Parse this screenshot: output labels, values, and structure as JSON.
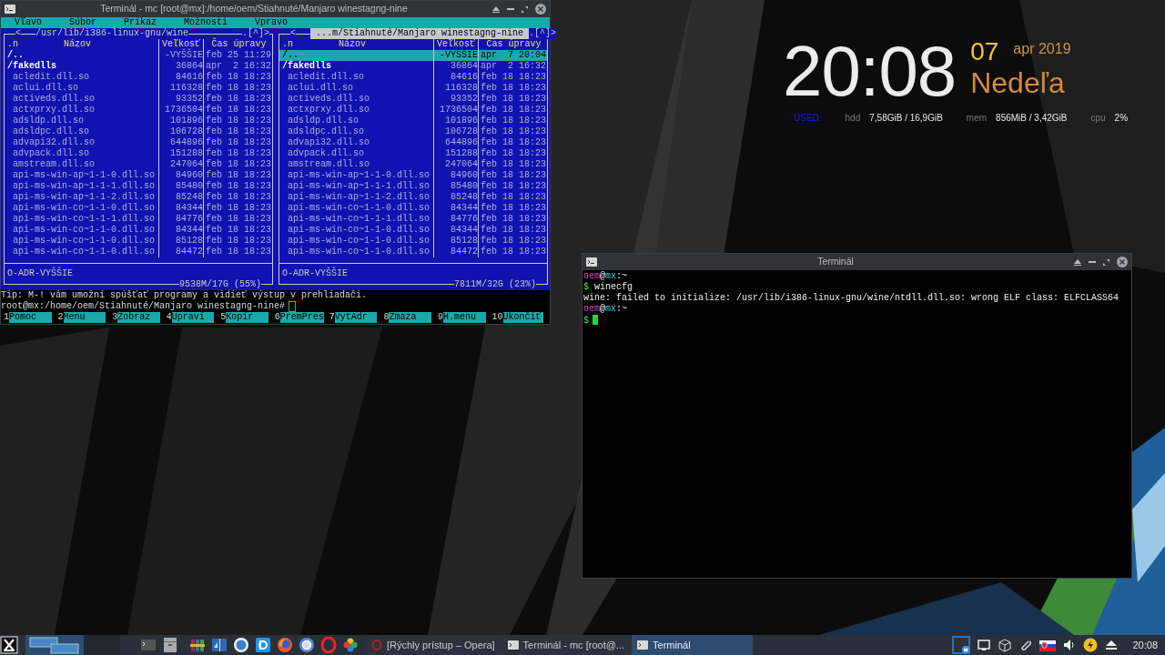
{
  "clock_widget": {
    "time": "20:08",
    "day": "07",
    "month_year": "apr 2019",
    "weekday": "Nedeľa",
    "used_label": "USED:",
    "stats": [
      {
        "label": "hdd",
        "value": "7,58GiB / 16,9GiB"
      },
      {
        "label": "mem",
        "value": "856MiB / 3,42GiB"
      },
      {
        "label": "cpu",
        "value": "2%"
      }
    ]
  },
  "mc_window": {
    "title": "Terminál - mc [root@mx]:/home/oem/Stiahnuté/Manjaro winestagng-nine",
    "menu": [
      "Vľavo",
      "Súbor",
      "Príkaz",
      "Možnosti",
      "Vpravo"
    ],
    "panels": [
      {
        "active": false,
        "marker_left": "<",
        "path": "/usr/lib/i386-linux-gnu/wine",
        "marker_right": ".[^]>",
        "sort": ".n",
        "columns": [
          "Názov",
          "Veľkosť",
          "Čas úpravy"
        ],
        "rows": [
          {
            "name": "/..",
            "size": "-VYŠŠIE",
            "modified": "feb 25 11:29",
            "kind": "dir",
            "selected": false
          },
          {
            "name": "/fakedlls",
            "size": "36864",
            "modified": "apr  2 16:32",
            "kind": "dir",
            "selected": false
          },
          {
            "name": "acledit.dll.so",
            "size": "84616",
            "modified": "feb 18 18:23",
            "kind": "file",
            "selected": false
          },
          {
            "name": "aclui.dll.so",
            "size": "116328",
            "modified": "feb 18 18:23",
            "kind": "file",
            "selected": false
          },
          {
            "name": "activeds.dll.so",
            "size": "93352",
            "modified": "feb 18 18:23",
            "kind": "file",
            "selected": false
          },
          {
            "name": "actxprxy.dll.so",
            "size": "1736504",
            "modified": "feb 18 18:23",
            "kind": "file",
            "selected": false
          },
          {
            "name": "adsldp.dll.so",
            "size": "101896",
            "modified": "feb 18 18:23",
            "kind": "file",
            "selected": false
          },
          {
            "name": "adsldpc.dll.so",
            "size": "106728",
            "modified": "feb 18 18:23",
            "kind": "file",
            "selected": false
          },
          {
            "name": "advapi32.dll.so",
            "size": "644896",
            "modified": "feb 18 18:23",
            "kind": "file",
            "selected": false
          },
          {
            "name": "advpack.dll.so",
            "size": "151288",
            "modified": "feb 18 18:23",
            "kind": "file",
            "selected": false
          },
          {
            "name": "amstream.dll.so",
            "size": "247064",
            "modified": "feb 18 18:23",
            "kind": "file",
            "selected": false
          },
          {
            "name": "api-ms-win-ap~1-1-0.dll.so",
            "size": "84960",
            "modified": "feb 18 18:23",
            "kind": "file",
            "selected": false
          },
          {
            "name": "api-ms-win-ap~1-1-1.dll.so",
            "size": "85480",
            "modified": "feb 18 18:23",
            "kind": "file",
            "selected": false
          },
          {
            "name": "api-ms-win-ap~1-1-2.dll.so",
            "size": "85248",
            "modified": "feb 18 18:23",
            "kind": "file",
            "selected": false
          },
          {
            "name": "api-ms-win-co~1-1-0.dll.so",
            "size": "84344",
            "modified": "feb 18 18:23",
            "kind": "file",
            "selected": false
          },
          {
            "name": "api-ms-win-co~1-1-1.dll.so",
            "size": "84776",
            "modified": "feb 18 18:23",
            "kind": "file",
            "selected": false
          },
          {
            "name": "api-ms-win-co~1-1-0.dll.so",
            "size": "84344",
            "modified": "feb 18 18:23",
            "kind": "file",
            "selected": false
          },
          {
            "name": "api-ms-win-co~1-1-0.dll.so",
            "size": "85128",
            "modified": "feb 18 18:23",
            "kind": "file",
            "selected": false
          },
          {
            "name": "api-ms-win-co~1-1-0.dll.so",
            "size": "84472",
            "modified": "feb 18 18:23",
            "kind": "file",
            "selected": false
          }
        ],
        "mini_status": "O-ADR-VYŠŠIE",
        "disk": "9538M/17G (55%)"
      },
      {
        "active": true,
        "marker_left": "<",
        "path": " ...m/Stiahnuté/Manjaro winestagng-nine ",
        "marker_right": ".[^]>",
        "sort": ".n",
        "columns": [
          "Názov",
          "Veľkosť",
          "Čas úpravy"
        ],
        "rows": [
          {
            "name": "/..",
            "size": "-VYŠŠIE",
            "modified": "apr  7 20:04",
            "kind": "dir",
            "selected": true
          },
          {
            "name": "/fakedlls",
            "size": "36864",
            "modified": "apr  2 16:32",
            "kind": "dir",
            "selected": false
          },
          {
            "name": "acledit.dll.so",
            "size": "84616",
            "modified": "feb 18 18:23",
            "kind": "file",
            "selected": false
          },
          {
            "name": "aclui.dll.so",
            "size": "116328",
            "modified": "feb 18 18:23",
            "kind": "file",
            "selected": false
          },
          {
            "name": "activeds.dll.so",
            "size": "93352",
            "modified": "feb 18 18:23",
            "kind": "file",
            "selected": false
          },
          {
            "name": "actxprxy.dll.so",
            "size": "1736504",
            "modified": "feb 18 18:23",
            "kind": "file",
            "selected": false
          },
          {
            "name": "adsldp.dll.so",
            "size": "101896",
            "modified": "feb 18 18:23",
            "kind": "file",
            "selected": false
          },
          {
            "name": "adsldpc.dll.so",
            "size": "106728",
            "modified": "feb 18 18:23",
            "kind": "file",
            "selected": false
          },
          {
            "name": "advapi32.dll.so",
            "size": "644896",
            "modified": "feb 18 18:23",
            "kind": "file",
            "selected": false
          },
          {
            "name": "advpack.dll.so",
            "size": "151288",
            "modified": "feb 18 18:23",
            "kind": "file",
            "selected": false
          },
          {
            "name": "amstream.dll.so",
            "size": "247064",
            "modified": "feb 18 18:23",
            "kind": "file",
            "selected": false
          },
          {
            "name": "api-ms-win-ap~1-1-0.dll.so",
            "size": "84960",
            "modified": "feb 18 18:23",
            "kind": "file",
            "selected": false
          },
          {
            "name": "api-ms-win-ap~1-1-1.dll.so",
            "size": "85480",
            "modified": "feb 18 18:23",
            "kind": "file",
            "selected": false
          },
          {
            "name": "api-ms-win-ap~1-1-2.dll.so",
            "size": "85248",
            "modified": "feb 18 18:23",
            "kind": "file",
            "selected": false
          },
          {
            "name": "api-ms-win-co~1-1-0.dll.so",
            "size": "84344",
            "modified": "feb 18 18:23",
            "kind": "file",
            "selected": false
          },
          {
            "name": "api-ms-win-co~1-1-1.dll.so",
            "size": "84776",
            "modified": "feb 18 18:23",
            "kind": "file",
            "selected": false
          },
          {
            "name": "api-ms-win-co~1-1-0.dll.so",
            "size": "84344",
            "modified": "feb 18 18:23",
            "kind": "file",
            "selected": false
          },
          {
            "name": "api-ms-win-co~1-1-0.dll.so",
            "size": "85128",
            "modified": "feb 18 18:23",
            "kind": "file",
            "selected": false
          },
          {
            "name": "api-ms-win-co~1-1-0.dll.so",
            "size": "84472",
            "modified": "feb 18 18:23",
            "kind": "file",
            "selected": false
          }
        ],
        "mini_status": "O-ADR-VYŠŠIE",
        "disk": "7811M/32G (23%)"
      }
    ],
    "tip": "Tip: M-! vám umožní spúšťať programy a vidieť výstup v prehliadači.",
    "prompt": "root@mx:/home/oem/Stiahnuté/Manjaro winestagng-nine#",
    "cursor": true,
    "function_keys": [
      {
        "number": "1",
        "label": "Pomoc"
      },
      {
        "number": "2",
        "label": "Menu"
      },
      {
        "number": "3",
        "label": "Zobraz"
      },
      {
        "number": "4",
        "label": "Upraví"
      },
      {
        "number": "5",
        "label": "Kopír"
      },
      {
        "number": "6",
        "label": "PremPres"
      },
      {
        "number": "7",
        "label": "VytAdr"
      },
      {
        "number": "8",
        "label": "Zmaza"
      },
      {
        "number": "9",
        "label": "H.menu"
      },
      {
        "number": "10",
        "label": "Ukončiť"
      }
    ]
  },
  "terminal_window": {
    "title": "Terminál",
    "lines": [
      {
        "kind": "prompt",
        "user": "oem",
        "at": "@",
        "host": "mx",
        "path": ":~"
      },
      {
        "kind": "command",
        "sign": "$",
        "text": "winecfg",
        "cursor": false
      },
      {
        "kind": "output",
        "text": "wine: failed to initialize: /usr/lib/i386-linux-gnu/wine/ntdll.dll.so: wrong ELF class: ELFCLASS64"
      },
      {
        "kind": "prompt",
        "user": "oem",
        "at": "@",
        "host": "mx",
        "path": ":~"
      },
      {
        "kind": "command",
        "sign": "$",
        "cursor": true
      }
    ]
  },
  "taskbar": {
    "tasks": [
      {
        "kind": "browser",
        "label": "[Rýchly prístup – Opera]",
        "selected": false
      },
      {
        "kind": "terminal",
        "label": "Terminál - mc [root@...",
        "selected": false
      },
      {
        "kind": "terminal",
        "label": "Terminál",
        "selected": true
      }
    ],
    "clock": "20:08"
  }
}
